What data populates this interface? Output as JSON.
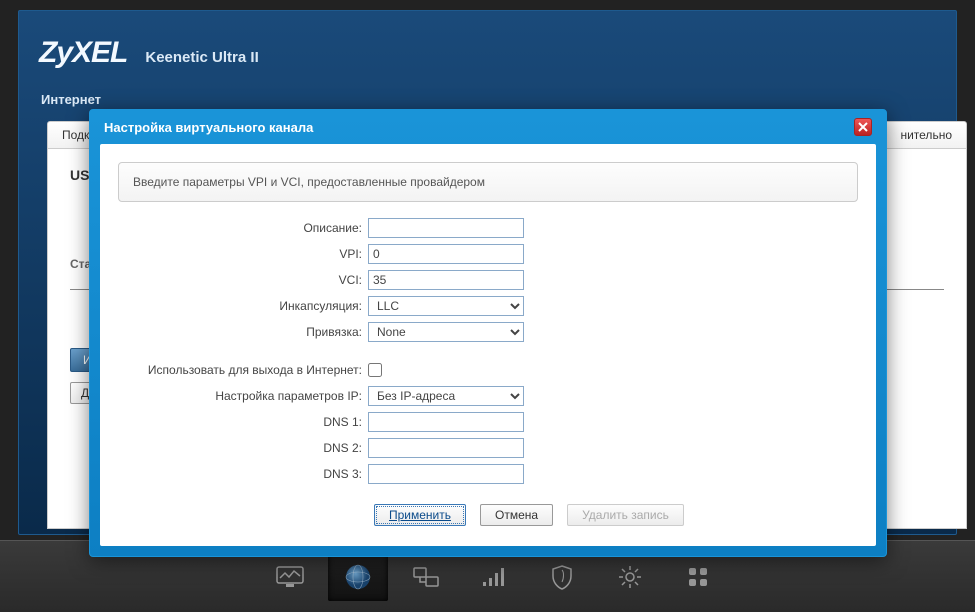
{
  "brand": "ZyXEL",
  "model": "Keenetic Ultra II",
  "breadcrumb": "Интернет",
  "tabs": {
    "first": "Подкл",
    "last": "нительно"
  },
  "page": {
    "title": "USB",
    "divider_label": "Станд",
    "btn_primary": "Инте",
    "btn_secondary": "Доб"
  },
  "modal": {
    "title": "Настройка виртуального канала",
    "hint": "Введите параметры VPI и VCI, предоставленные провайдером",
    "labels": {
      "description": "Описание:",
      "vpi": "VPI:",
      "vci": "VCI:",
      "encap": "Инкапсуляция:",
      "bind": "Привязка:",
      "use_internet": "Использовать для выхода в Интернет:",
      "ip_setup": "Настройка параметров IP:",
      "dns1": "DNS 1:",
      "dns2": "DNS 2:",
      "dns3": "DNS 3:"
    },
    "values": {
      "description": "",
      "vpi": "0",
      "vci": "35",
      "encap": "LLC",
      "bind": "None",
      "use_internet": false,
      "ip_setup": "Без IP-адреса",
      "dns1": "",
      "dns2": "",
      "dns3": ""
    },
    "buttons": {
      "apply": "Применить",
      "cancel": "Отмена",
      "delete": "Удалить запись"
    }
  }
}
